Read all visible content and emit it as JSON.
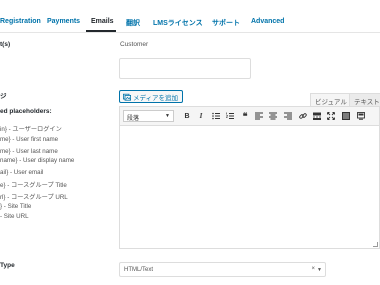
{
  "tabs": [
    "Registration",
    "Payments",
    "Emails",
    "翻訳",
    "LMSライセンス",
    "サポート",
    "Advanced"
  ],
  "subject": {
    "label": "t(s)",
    "value": "Customer"
  },
  "message": {
    "label": "ジ"
  },
  "placeholders": {
    "heading": "ed placeholders:",
    "items": [
      "in} - ユーザーログイン",
      "me} - User first name",
      "me} - User last name",
      "name} - User display name",
      "ail} - User email",
      "e} - コースグループ Title",
      "rl} - コースグループ URL",
      "} - Site Title",
      "- Site URL"
    ]
  },
  "editor": {
    "add_media": "メディアを追加",
    "tab_visual": "ビジュアル",
    "tab_text": "テキスト",
    "format": "段落"
  },
  "email_type": {
    "label": "Type",
    "value": "HTML/Text"
  },
  "colors": {
    "accent": "#0073aa",
    "active": "#23282d"
  },
  "icons": [
    "media-icon",
    "bold-icon",
    "italic-icon",
    "bullet-list-icon",
    "numbered-list-icon",
    "blockquote-icon",
    "align-left-icon",
    "align-center-icon",
    "align-right-icon",
    "link-icon",
    "insert-more-icon",
    "fullscreen-icon",
    "toolbar-toggle-icon",
    "add-form-icon"
  ]
}
